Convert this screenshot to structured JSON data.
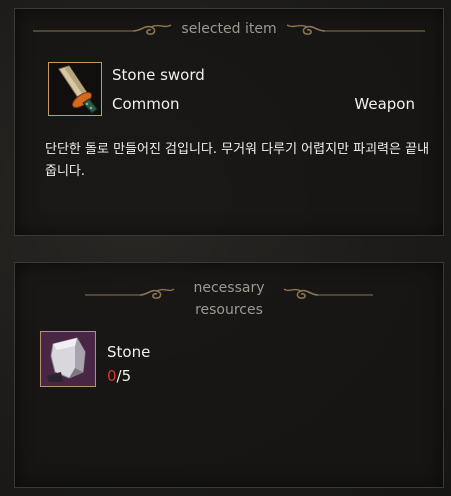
{
  "selected_panel": {
    "header": "selected item",
    "item": {
      "icon": "stone-sword-icon",
      "name": "Stone sword",
      "rarity": "Common",
      "type": "Weapon",
      "description": "단단한 돌로 만들어진 검입니다. 무거워 다루기 어렵지만 파괴력은 끝내줍니다."
    }
  },
  "resources_panel": {
    "header": "necessary resources",
    "resources": [
      {
        "icon": "stone-icon",
        "name": "Stone",
        "have": "0",
        "separator": "/",
        "need": "5"
      }
    ]
  },
  "colors": {
    "panel_border": "#3a3835",
    "ornament": "#8a7452",
    "header_text": "#9c988f",
    "text": "#f2f0ea",
    "insufficient": "#d23a2e",
    "icon_border_item": "#c69a63",
    "icon_border_resource": "#b49072"
  }
}
